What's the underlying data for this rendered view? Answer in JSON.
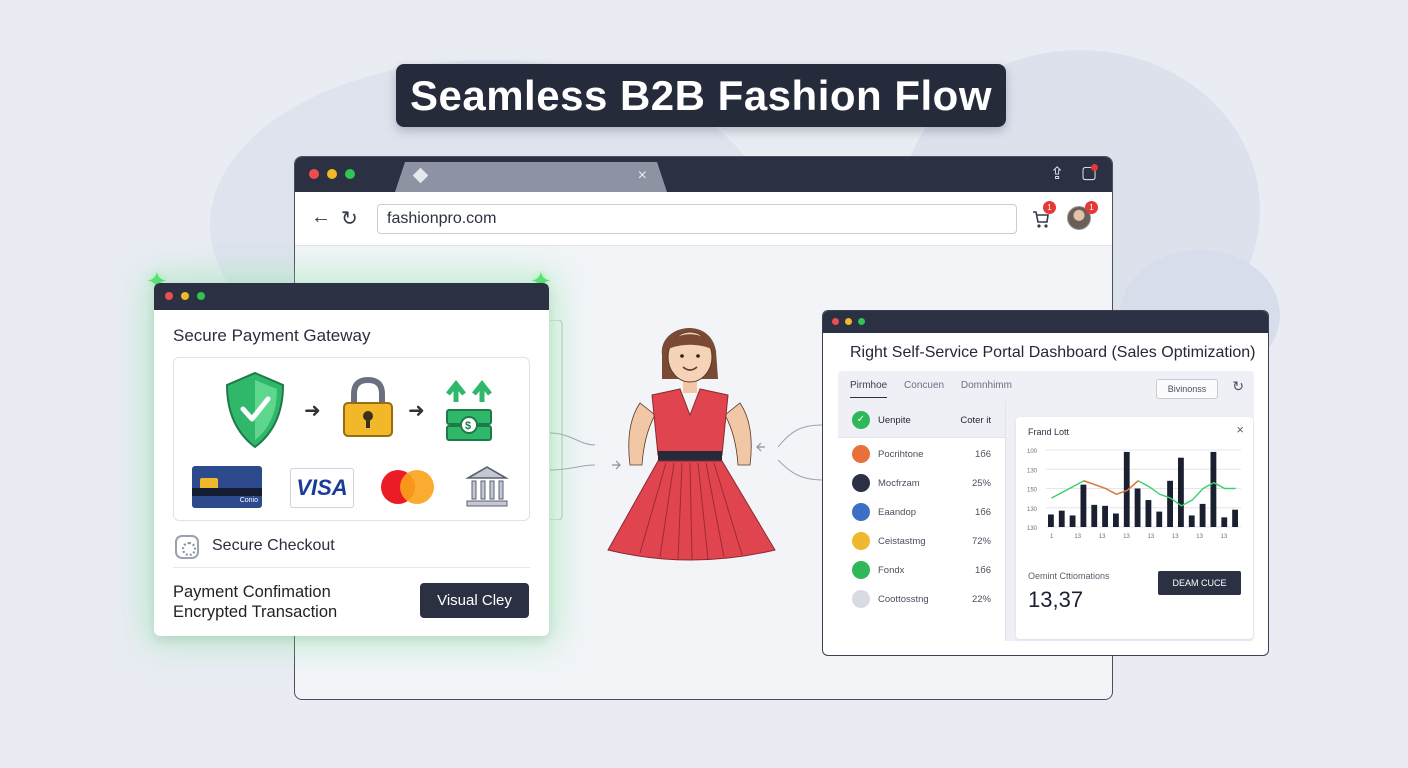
{
  "hero": {
    "title": "Seamless B2B Fashion Flow"
  },
  "browser": {
    "tab": {
      "close": "×"
    },
    "toolbar": {
      "back": "←",
      "reload": "↻",
      "url": "fashionpro.com",
      "cart_badge": "1",
      "avatar_badge": "1"
    },
    "chrome_icons": {
      "share": "⇪",
      "bookmark": "▢"
    }
  },
  "payment_window": {
    "title": "Secure Payment Gateway",
    "flow_icons": [
      "shield-check-icon",
      "lock-icon",
      "money-transfer-icon"
    ],
    "methods": {
      "card_label": "Conio",
      "visa": "VISA"
    },
    "checkout": "Secure Checkout",
    "confirmation_line1": "Payment Confimation",
    "confirmation_line2": "Encrypted Transaction",
    "button": "Visual Cley"
  },
  "dashboard": {
    "title": "Right Self-Service Portal Dashboard (Sales Optimization)",
    "tabs": [
      "Pirmhoe",
      "Concuen",
      "Domnhimm"
    ],
    "button": "Bivinonss",
    "list_header": {
      "name": "Uenpite",
      "value": "Coter it"
    },
    "list": [
      {
        "name": "Pocrihtone",
        "value": "1б6",
        "color": "#e8703a"
      },
      {
        "name": "Mocfrzam",
        "value": "25%",
        "color": "#2b3142"
      },
      {
        "name": "Eaandop",
        "value": "1б6",
        "color": "#3d6fc4"
      },
      {
        "name": "Ceistastmg",
        "value": "72%",
        "color": "#f0b82e"
      },
      {
        "name": "Fondx",
        "value": "1б6",
        "color": "#2fb85a"
      },
      {
        "name": "Coottosstng",
        "value": "22%",
        "color": "#d8dbe2"
      }
    ],
    "chart_card": {
      "title": "Frand Lott",
      "close": "×",
      "metric_label": "Oemint Cttiomations",
      "metric_value": "13,37",
      "button": "DEAM CUCE"
    }
  },
  "chart_data": {
    "type": "bar",
    "title": "Frand Lott",
    "y_ticks": [
      "100",
      "130",
      "150",
      "130",
      "130"
    ],
    "x_ticks": [
      "1",
      "13",
      "13",
      "13",
      "13",
      "13",
      "13",
      "13"
    ],
    "values": [
      13,
      17,
      12,
      44,
      23,
      22,
      14,
      78,
      40,
      28,
      16,
      48,
      72,
      12,
      24,
      78,
      10,
      18
    ],
    "series": [
      {
        "name": "",
        "values": [
          30,
          36,
          42,
          48,
          44,
          40,
          34,
          38,
          48,
          42,
          34,
          30,
          22,
          28,
          40,
          46,
          40,
          40
        ]
      }
    ],
    "colors": {
      "bars": "#1b2030",
      "line": "#3ad06a",
      "highlight": "#e8703a"
    }
  }
}
